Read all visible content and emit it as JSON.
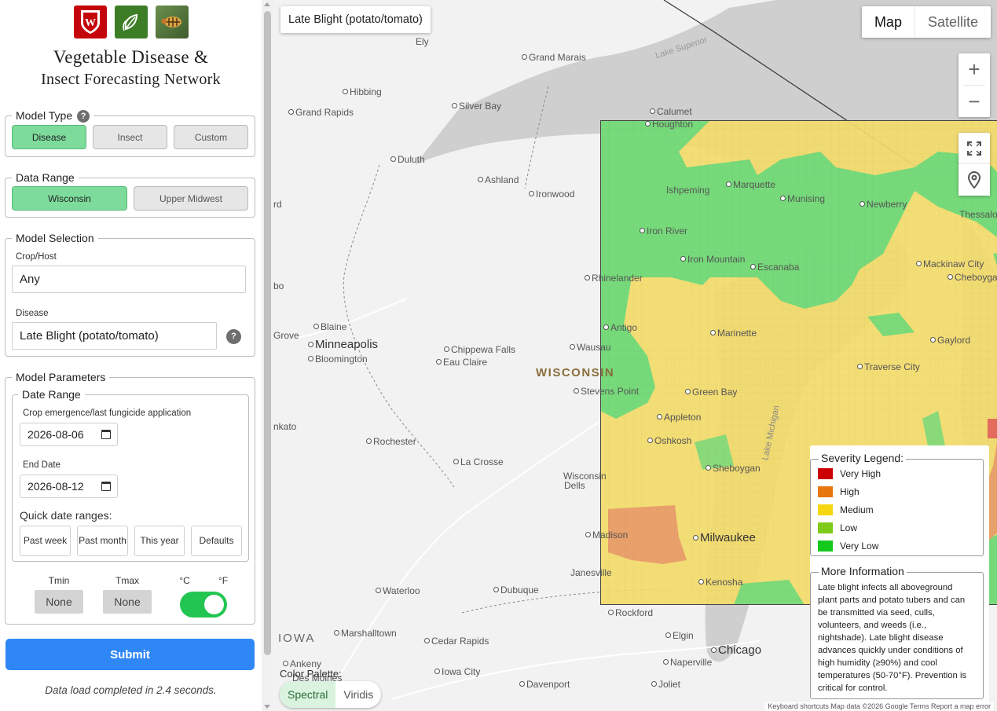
{
  "sidebar": {
    "title_line1": "Vegetable Disease &",
    "title_line2": "Insect Forecasting Network",
    "model_type": {
      "legend": "Model Type",
      "help": "?",
      "buttons": [
        "Disease",
        "Insect",
        "Custom"
      ],
      "selected": "Disease"
    },
    "data_range": {
      "legend": "Data Range",
      "buttons": [
        "Wisconsin",
        "Upper Midwest"
      ],
      "selected": "Wisconsin"
    },
    "model_selection": {
      "legend": "Model Selection",
      "crop_label": "Crop/Host",
      "crop_value": "Any",
      "disease_label": "Disease",
      "disease_value": "Late Blight (potato/tomato)",
      "help": "?"
    },
    "model_parameters": {
      "legend": "Model Parameters",
      "date_range_legend": "Date Range",
      "start_label": "Crop emergence/last fungicide application",
      "start_value": "2026-08-06",
      "end_label": "End Date",
      "end_value": "2026-08-12",
      "quick_label": "Quick date ranges:",
      "quick_buttons": [
        "Past week",
        "Past month",
        "This year",
        "Defaults"
      ],
      "tmin_label": "Tmin",
      "tmin_value": "None",
      "tmax_label": "Tmax",
      "tmax_value": "None",
      "unit_c": "°C",
      "unit_f": "°F",
      "unit_selected": "°F"
    },
    "submit_label": "Submit",
    "status_text": "Data load completed in 2.4 seconds."
  },
  "map": {
    "title": "Late Blight (potato/tomato)",
    "map_type_buttons": [
      "Map",
      "Satellite"
    ],
    "map_type_selected": "Map",
    "zoom_in": "+",
    "zoom_out": "−",
    "labels": {
      "grand_marais": "Grand Marais",
      "ely": "Ely",
      "lake_superior": "Lake Superior",
      "hibbing": "Hibbing",
      "silver_bay": "Silver Bay",
      "grand_rapids": "Grand Rapids",
      "calumet": "Calumet",
      "houghton": "Houghton",
      "duluth": "Duluth",
      "ashland": "Ashland",
      "ironwood": "Ironwood",
      "ishpeming": "Ishpeming",
      "marquette": "Marquette",
      "munising": "Munising",
      "newberry": "Newberry",
      "thessalon": "Thessalo",
      "iron_river": "Iron River",
      "iron_mountain": "Iron Mountain",
      "escanaba": "Escanaba",
      "rhinelander": "Rhinelander",
      "mackinaw": "Mackinaw City",
      "cheboygan": "Cheboygan",
      "blaine": "Blaine",
      "grove": "Grove",
      "minneapolis": "Minneapolis",
      "bloomington": "Bloomington",
      "antigo": "Antigo",
      "marinette": "Marinette",
      "chippewa": "Chippewa Falls",
      "wausau": "Wausau",
      "gaylord": "Gaylord",
      "eau_claire": "Eau Claire",
      "wisconsin": "WISCONSIN",
      "traverse": "Traverse City",
      "stevens_point": "Stevens Point",
      "green_bay": "Green Bay",
      "appleton": "Appleton",
      "kato": "nkato",
      "oshkosh": "Oshkosh",
      "rochester": "Rochester",
      "la_crosse": "La Crosse",
      "sheboygan": "Sheboygan",
      "wisconsin_dells_1": "Wisconsin",
      "wisconsin_dells_2": "Dells",
      "madison": "Madison",
      "milwaukee": "Milwaukee",
      "janesville": "Janesville",
      "kenosha": "Kenosha",
      "waterloo": "Waterloo",
      "dubuque": "Dubuque",
      "rockford": "Rockford",
      "iowa": "IOWA",
      "marshalltown": "Marshalltown",
      "cedar_rapids": "Cedar Rapids",
      "elgin": "Elgin",
      "chicago": "Chicago",
      "ankeny": "Ankeny",
      "des_moines": "Des Moines",
      "iowa_city": "Iowa City",
      "naperville": "Naperville",
      "davenport": "Davenport",
      "joliet": "Joliet",
      "edge_rd": "rd",
      "lake_michigan": "Lake Michigan"
    },
    "palette_label": "Color Palette:",
    "palette_buttons": [
      "Spectral",
      "Viridis"
    ],
    "palette_selected": "Spectral",
    "attribution": "Keyboard shortcuts    Map data ©2026 Google    Terms    Report a map error"
  },
  "severity_legend": {
    "title": "Severity Legend:",
    "items": [
      {
        "label": "Very High",
        "color": "#cc0000"
      },
      {
        "label": "High",
        "color": "#e8770e"
      },
      {
        "label": "Medium",
        "color": "#f5d60f"
      },
      {
        "label": "Low",
        "color": "#7fcb1a"
      },
      {
        "label": "Very Low",
        "color": "#15c91c"
      }
    ]
  },
  "more_information": {
    "title": "More Information",
    "text": "Late blight infects all aboveground plant parts and potato tubers and can be transmitted via seed, culls, volunteers, and weeds (i.e., nightshade). Late blight disease advances quickly under conditions of high humidity (≥90%) and cool temperatures (50-70°F). Prevention is critical for control."
  },
  "colors": {
    "accent_green": "#7ddc9c",
    "submit_blue": "#2f87f5",
    "toggle_green": "#23c552",
    "grid_low": "#6fd97a",
    "grid_medium": "#f3db6a",
    "grid_high": "#e89a6a",
    "grid_veryhigh": "#e05858"
  }
}
